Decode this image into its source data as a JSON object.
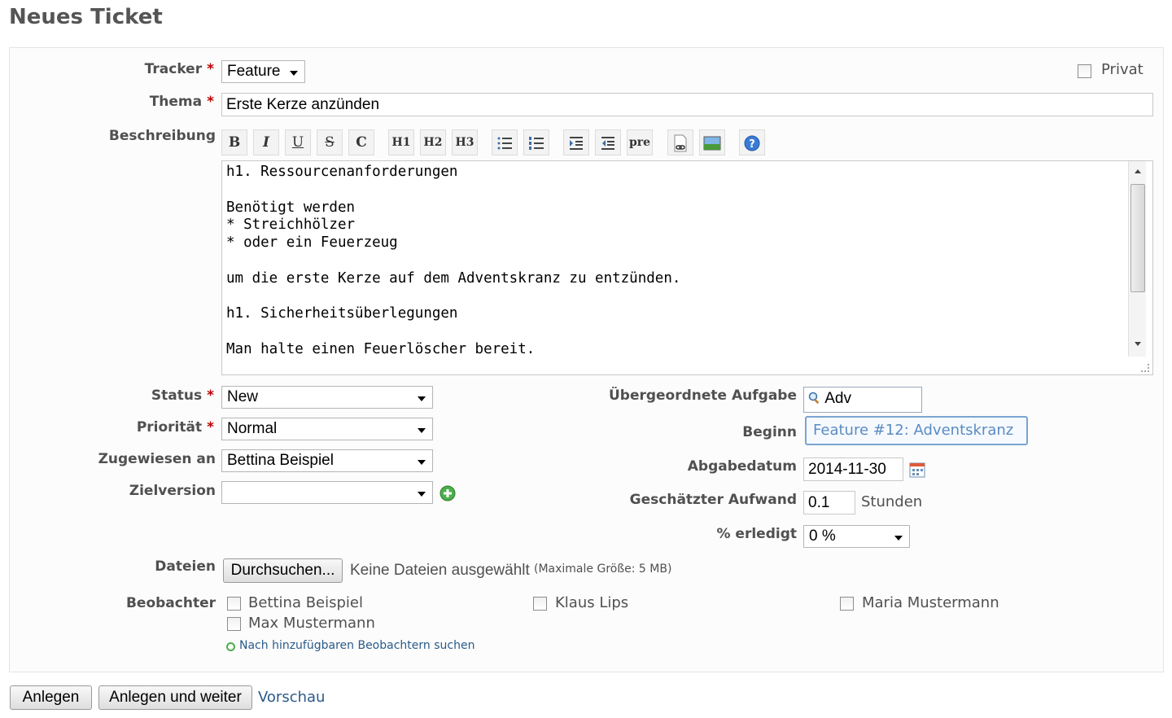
{
  "page": {
    "title": "Neues Ticket"
  },
  "form": {
    "tracker": {
      "label": "Tracker",
      "required": "*",
      "value": "Feature"
    },
    "private": {
      "label": "Privat"
    },
    "subject": {
      "label": "Thema",
      "required": "*",
      "value": "Erste Kerze anzünden"
    },
    "description": {
      "label": "Beschreibung",
      "toolbar": [
        "B",
        "I",
        "U",
        "S",
        "C",
        "H1",
        "H2",
        "H3",
        "ul",
        "ol",
        "indent",
        "outdent",
        "pre",
        "link",
        "image",
        "help"
      ],
      "text": "h1. Ressourcenanforderungen\n\nBenötigt werden\n* Streichhölzer\n* oder ein Feuerzeug\n\num die erste Kerze auf dem Adventskranz zu entzünden.\n\nh1. Sicherheitsüberlegungen\n\nMan halte einen Feuerlöscher bereit."
    },
    "status": {
      "label": "Status",
      "required": "*",
      "value": "New"
    },
    "priority": {
      "label": "Priorität",
      "required": "*",
      "value": "Normal"
    },
    "assignee": {
      "label": "Zugewiesen an",
      "value": "Bettina Beispiel"
    },
    "target_version": {
      "label": "Zielversion",
      "value": ""
    },
    "parent_task": {
      "label": "Übergeordnete Aufgabe",
      "value": "Adv",
      "suggestion": "Feature #12: Adventskranz"
    },
    "start_date": {
      "label": "Beginn"
    },
    "due_date": {
      "label": "Abgabedatum",
      "value": "2014-11-30"
    },
    "estimated": {
      "label": "Geschätzter Aufwand",
      "value": "0.1",
      "unit": "Stunden"
    },
    "done_ratio": {
      "label": "% erledigt",
      "value": "0 %"
    },
    "files": {
      "label": "Dateien",
      "button": "Durchsuchen...",
      "status": "Keine Dateien ausgewählt",
      "max": "(Maximale Größe: 5 MB)"
    },
    "watchers": {
      "label": "Beobachter",
      "people": [
        "Bettina Beispiel",
        "Klaus Lips",
        "Maria Mustermann",
        "Max Mustermann"
      ],
      "search_link": "Nach hinzufügbaren Beobachtern suchen"
    }
  },
  "actions": {
    "create": "Anlegen",
    "create_continue": "Anlegen und weiter",
    "preview": "Vorschau"
  },
  "colors": {
    "required": "#bb0000",
    "link": "#2a5a8a",
    "add_icon": "#4cae4c",
    "help_icon": "#3a7bd5"
  }
}
